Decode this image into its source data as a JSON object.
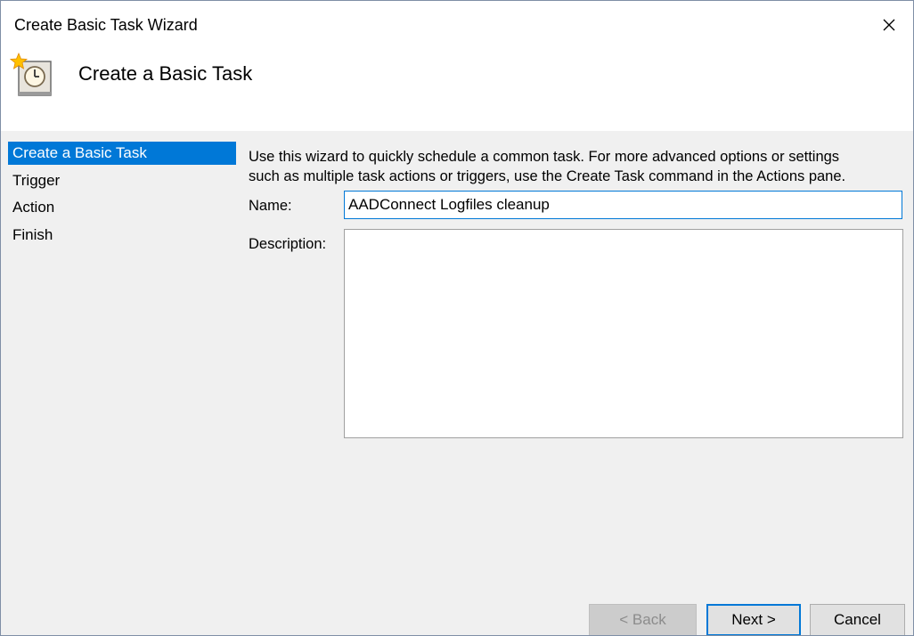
{
  "window": {
    "title": "Create Basic Task Wizard",
    "close_glyph": "✕"
  },
  "header": {
    "icon": "task-scheduler-clock-icon",
    "title": "Create a Basic Task"
  },
  "sidebar": {
    "items": [
      {
        "label": "Create a Basic Task",
        "selected": true
      },
      {
        "label": "Trigger",
        "selected": false
      },
      {
        "label": "Action",
        "selected": false
      },
      {
        "label": "Finish",
        "selected": false
      }
    ]
  },
  "main": {
    "instructions_line1": "Use this wizard to quickly schedule a common task.  For more advanced options or settings",
    "instructions_line2": "such as multiple task actions or triggers, use the Create Task command in the Actions pane.",
    "name_label": "Name:",
    "name_value": "AADConnect Logfiles cleanup",
    "description_label": "Description:",
    "description_value": ""
  },
  "buttons": {
    "back_label": "< Back",
    "next_label": "Next >",
    "cancel_label": "Cancel"
  },
  "colors": {
    "accent": "#0078d7",
    "window_bg": "#f0f0f0",
    "header_bg": "#ffffff"
  }
}
